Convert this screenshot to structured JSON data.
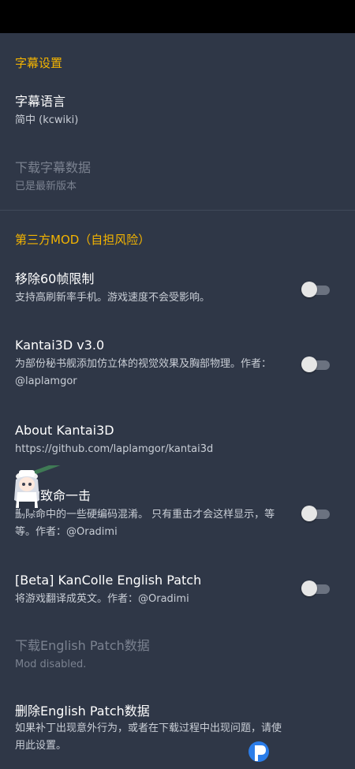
{
  "sections": {
    "subtitles": {
      "header": "字幕设置",
      "items": {
        "language": {
          "title": "字幕语言",
          "summary": "简中 (kcwiki)"
        },
        "download": {
          "title": "下载字幕数据",
          "summary": "已是最新版本"
        }
      }
    },
    "mods": {
      "header": "第三方MOD（自担风险）",
      "items": {
        "fps": {
          "title": "移除60帧限制",
          "summary": "支持高刷新率手机。游戏速度不会受影响。",
          "enabled": false
        },
        "kantai3d": {
          "title": "Kantai3D v3.0",
          "summary": "为部份秘书舰添加仿立体的视觉效果及胸部物理。作者：@laplamgor",
          "enabled": false
        },
        "about_kantai3d": {
          "title": "About Kantai3D",
          "summary": "https://github.com/laplamgor/kantai3d"
        },
        "critical": {
          "title": "真的致命一击",
          "summary": "删除命中的一些硬编码混淆。 只有重击才会这样显示，等等。作者：@Oradimi",
          "enabled": false
        },
        "english_patch": {
          "title": "[Beta] KanColle English Patch",
          "summary": "将游戏翻译成英文。作者：@Oradimi",
          "enabled": false
        },
        "download_patch": {
          "title": "下载English Patch数据",
          "summary": "Mod disabled."
        },
        "delete_patch": {
          "title": "删除English Patch数据",
          "summary": "如果补丁出现意外行为，或者在下载过程中出现问题，请使用此设置。"
        }
      }
    }
  },
  "colors": {
    "background": "#2f3747",
    "accent": "#f4b400",
    "summary": "#c9ced6",
    "disabled": "#7b8290"
  },
  "icons": {
    "mascot": "anime-mascot-icon",
    "watermark": "watermark-logo-icon"
  }
}
